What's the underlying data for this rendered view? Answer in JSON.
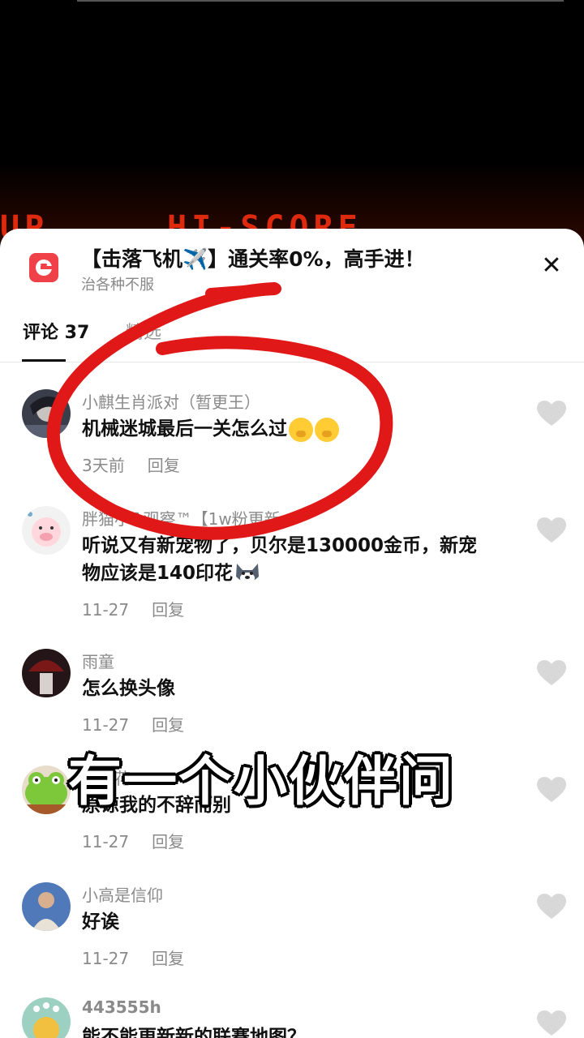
{
  "game": {
    "score_text_left": "UP",
    "score_text_right": "HI-SCORE"
  },
  "sheet": {
    "title": "【击落飞机✈️】通关率0%，高手进！",
    "subtitle": "治各种不服",
    "close": "✕",
    "app_icon": "app-logo-e"
  },
  "tabs": {
    "comments": "评论 37",
    "other": "精选"
  },
  "comments": [
    {
      "name": "小麒生肖派对（暂更王）",
      "text": "机械迷城最后一关怎么过",
      "time": "3天前",
      "reply": "回复",
      "emoji": "pleading-face"
    },
    {
      "name": "胖猫小&观察™【1w粉更新",
      "text_line1": "听说又有新宠物了，贝尔是130000金币，新宠",
      "text_line2": "物应该是140印花",
      "time": "11-27",
      "reply": "回复",
      "emoji": "husky-face"
    },
    {
      "name": "雨童",
      "text": "怎么换头像",
      "time": "11-27",
      "reply": "回复"
    },
    {
      "name": "一枝花",
      "text": "原谅我的不辞而别",
      "time": "11-27",
      "reply": "回复"
    },
    {
      "name": "小高是信仰",
      "text": "好诶",
      "time": "11-27",
      "reply": "回复"
    },
    {
      "name": "443555h",
      "text": "能不能更新新的联赛地图？",
      "time": "",
      "reply": ""
    }
  ],
  "overlay": {
    "caption": "有一个小伙伴问"
  },
  "colors": {
    "annotation_red": "#e01818",
    "logo_red": "#f04048",
    "heart_gray": "#d8d8d8"
  }
}
